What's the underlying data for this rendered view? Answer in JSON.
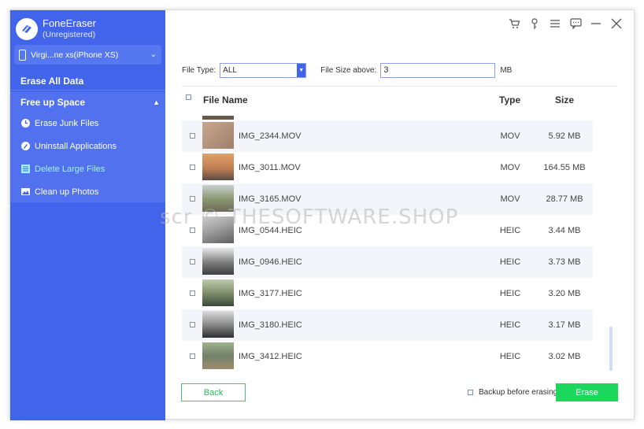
{
  "app": {
    "name": "FoneEraser",
    "status": "(Unregistered)"
  },
  "device": {
    "label": "Virgi...ne xs(iPhone XS)"
  },
  "sidebar": {
    "erase_all": "Erase All Data",
    "free_space": {
      "label": "Free up Space",
      "items": [
        {
          "label": "Erase Junk Files",
          "icon": "clock-icon"
        },
        {
          "label": "Uninstall Applications",
          "icon": "rocket-icon"
        },
        {
          "label": "Delete Large Files",
          "icon": "file-list-icon"
        },
        {
          "label": "Clean up Photos",
          "icon": "photo-icon"
        }
      ],
      "active_index": 2
    }
  },
  "filters": {
    "file_type_label": "File Type:",
    "file_type_value": "ALL",
    "file_size_label": "File Size above:",
    "file_size_value": "3",
    "file_size_unit": "MB"
  },
  "table": {
    "headers": {
      "name": "File Name",
      "type": "Type",
      "size": "Size"
    },
    "rows": [
      {
        "name": "IMG_2344.MOV",
        "type": "MOV",
        "size": "5.92 MB",
        "thumb": "#b9977e"
      },
      {
        "name": "IMG_3011.MOV",
        "type": "MOV",
        "size": "164.55 MB",
        "thumb": "#c98a5a"
      },
      {
        "name": "IMG_3165.MOV",
        "type": "MOV",
        "size": "28.77 MB",
        "thumb": "#8e9a74"
      },
      {
        "name": "IMG_0544.HEIC",
        "type": "HEIC",
        "size": "3.44 MB",
        "thumb": "#9a9a9a"
      },
      {
        "name": "IMG_0946.HEIC",
        "type": "HEIC",
        "size": "3.73 MB",
        "thumb": "#7c7c7c"
      },
      {
        "name": "IMG_3177.HEIC",
        "type": "HEIC",
        "size": "3.20 MB",
        "thumb": "#7f8f6b"
      },
      {
        "name": "IMG_3180.HEIC",
        "type": "HEIC",
        "size": "3.17 MB",
        "thumb": "#8b8b8b"
      },
      {
        "name": "IMG_3412.HEIC",
        "type": "HEIC",
        "size": "3.02 MB",
        "thumb": "#71826a"
      }
    ]
  },
  "watermark": "scr © THESOFTWARE.SHOP",
  "footer": {
    "back_label": "Back",
    "backup_label": "Backup before erasing",
    "erase_label": "Erase"
  },
  "colors": {
    "sidebar": "#4164ea",
    "active_item": "#9ff3ff",
    "erase_button": "#1bd75c"
  }
}
